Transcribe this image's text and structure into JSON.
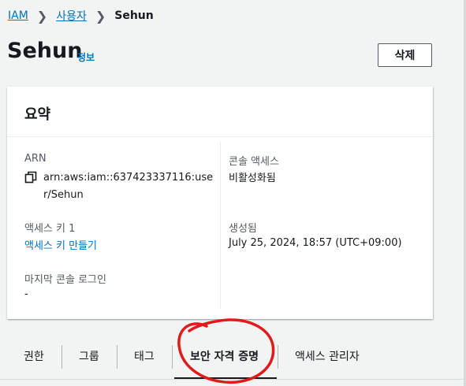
{
  "breadcrumb": {
    "items": [
      "IAM",
      "사용자"
    ],
    "current": "Sehun"
  },
  "header": {
    "title": "Sehun",
    "info_label": "정보",
    "delete_label": "삭제"
  },
  "summary": {
    "title": "요약",
    "arn_label": "ARN",
    "arn_value": "arn:aws:iam::637423337116:user/Sehun",
    "access_key_label": "액세스 키 1",
    "access_key_link": "액세스 키 만들기",
    "last_login_label": "마지막 콘솔 로그인",
    "last_login_value": "-",
    "console_access_label": "콘솔 액세스",
    "console_access_value": "비활성화됨",
    "created_label": "생성됨",
    "created_value": "July 25, 2024, 18:57 (UTC+09:00)"
  },
  "tabs": [
    {
      "label": "권한"
    },
    {
      "label": "그룹"
    },
    {
      "label": "태그"
    },
    {
      "label": "보안 자격 증명"
    },
    {
      "label": "액세스 관리자"
    }
  ],
  "colors": {
    "link": "#0073bb",
    "annotation": "#e01b1b"
  }
}
